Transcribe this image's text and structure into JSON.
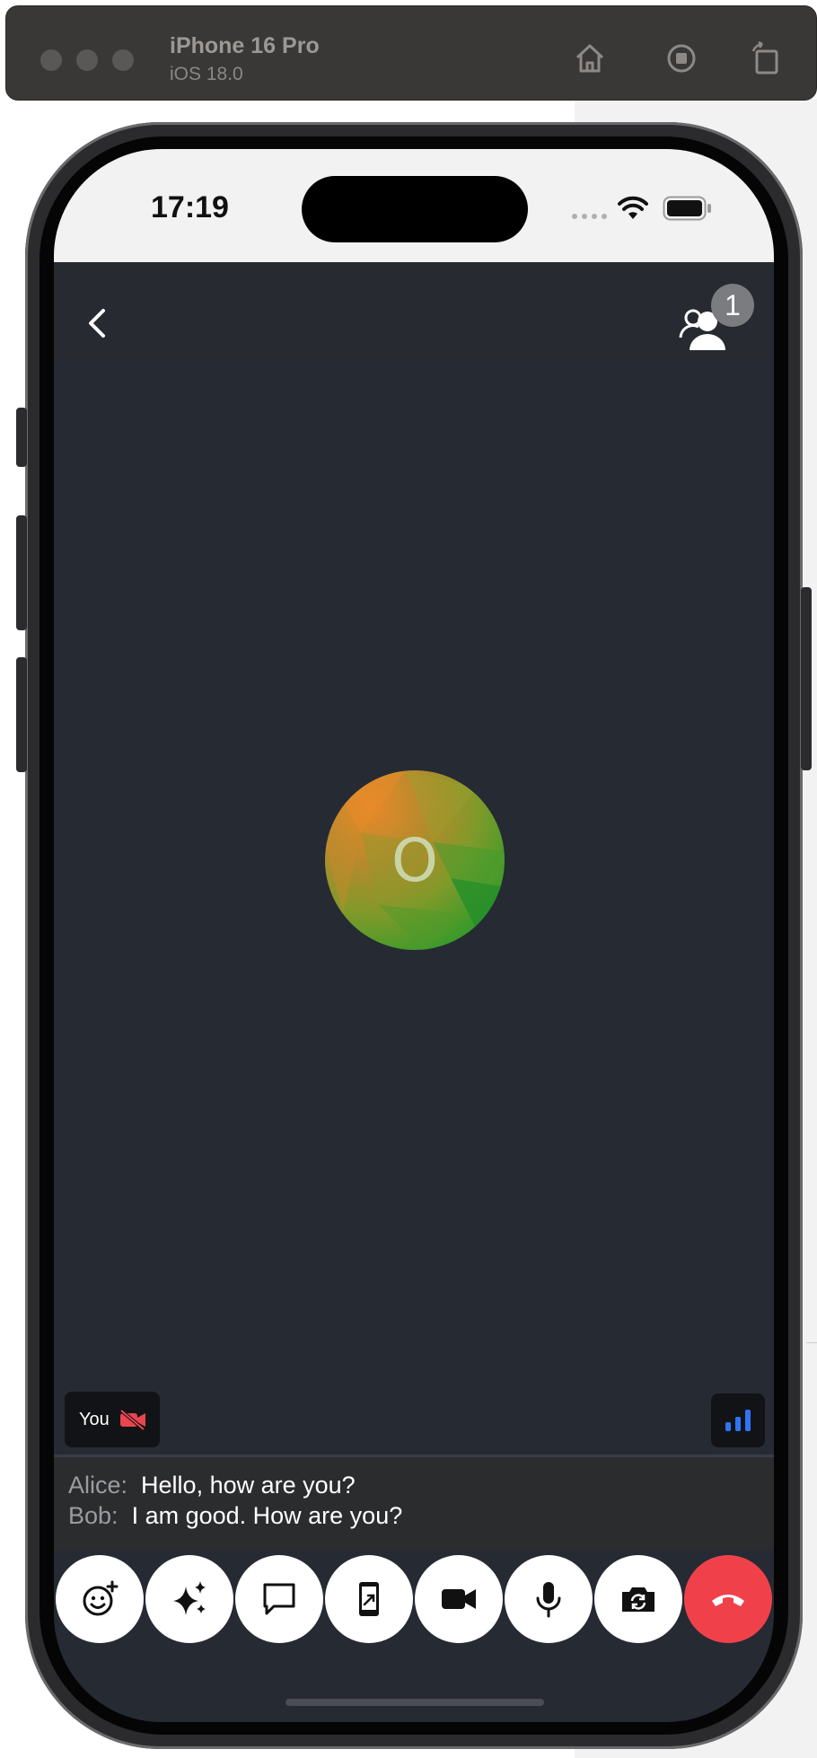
{
  "simulator": {
    "device_name": "iPhone 16 Pro",
    "os_version": "iOS 18.0",
    "icons": [
      "home-icon",
      "screenshot-icon",
      "rotate-icon"
    ]
  },
  "status_bar": {
    "time": "17:19",
    "icons": [
      "cellular-dots-icon",
      "wifi-icon",
      "battery-icon"
    ]
  },
  "call": {
    "participant_count": "1",
    "avatar_initial": "O",
    "self_label": "You",
    "accent_colors": {
      "end_call": "#f0414b",
      "video_off": "#e8454f",
      "signal": "#2f74f5"
    }
  },
  "chat": {
    "messages": [
      {
        "name": "Alice:",
        "text": "Hello, how are you?"
      },
      {
        "name": "Bob:",
        "text": "I am good. How are you?"
      }
    ]
  },
  "controls": [
    "emoji-reaction-icon",
    "sparkles-effects-icon",
    "chat-bubble-icon",
    "screen-share-icon",
    "video-camera-icon",
    "microphone-icon",
    "switch-camera-icon",
    "end-call-icon"
  ]
}
